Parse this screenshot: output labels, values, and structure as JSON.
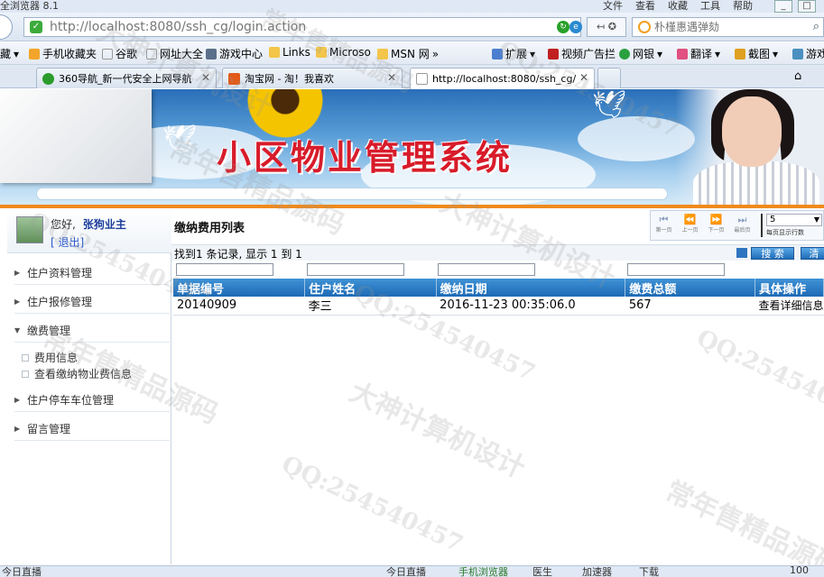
{
  "browser": {
    "window_title": "全浏览器 8.1",
    "menu": [
      "文件",
      "查看",
      "收藏",
      "工具",
      "帮助"
    ],
    "address": "http://localhost:8080/ssh_cg/login.action",
    "address_host": "localhost",
    "search_placeholder": "朴槿惠遇弹劾",
    "nav_label": "+"
  },
  "favorites": [
    "藏",
    "手机收藏夹",
    "谷歌",
    "网址大全",
    "游戏中心",
    "Links",
    "Microso",
    "MSN 网",
    "扩展",
    "视频广告拦",
    "网银",
    "翻译",
    "截图",
    "游戏"
  ],
  "tabs": [
    {
      "label": "360导航_新一代安全上网导航"
    },
    {
      "label": "淘宝网 - 淘！我喜欢"
    },
    {
      "label": "http://localhost:8080/ssh_cg/"
    }
  ],
  "banner": {
    "title": "小区物业管理系统"
  },
  "user": {
    "greeting": "您好,",
    "name": "张狗业主",
    "logout": "[ 退出]"
  },
  "sidebar": {
    "items": [
      {
        "label": "住户资料管理",
        "expanded": false
      },
      {
        "label": "住户报修管理",
        "expanded": false
      },
      {
        "label": "缴费管理",
        "expanded": true,
        "children": [
          "费用信息",
          "查看缴纳物业费信息"
        ]
      },
      {
        "label": "住户停车车位管理",
        "expanded": false
      },
      {
        "label": "留言管理",
        "expanded": false
      }
    ]
  },
  "main": {
    "title": "缴纳费用列表",
    "pager": {
      "buttons": [
        "第一页",
        "上一页",
        "下一页",
        "最后页"
      ],
      "page_size": "5",
      "page_size_hint": "每页显示行数"
    },
    "found_text": "找到1 条记录, 显示  1 到  1",
    "search_button": "搜 索",
    "clear_button": "清",
    "columns": [
      "单据编号",
      "住户姓名",
      "缴纳日期",
      "缴费总额",
      "具体操作"
    ],
    "rows": [
      {
        "id": "20140909",
        "name": "李三",
        "date": "2016-11-23 00:35:06.0",
        "amount": "567",
        "action": "查看详细信息"
      }
    ]
  },
  "statusbar": [
    "今日直播",
    "手机浏览器",
    "医生",
    "加速器",
    "下载",
    "100"
  ],
  "watermark": {
    "lines": [
      "大神计算机设计",
      "常年售精品源码",
      "QQ:254540457"
    ]
  }
}
